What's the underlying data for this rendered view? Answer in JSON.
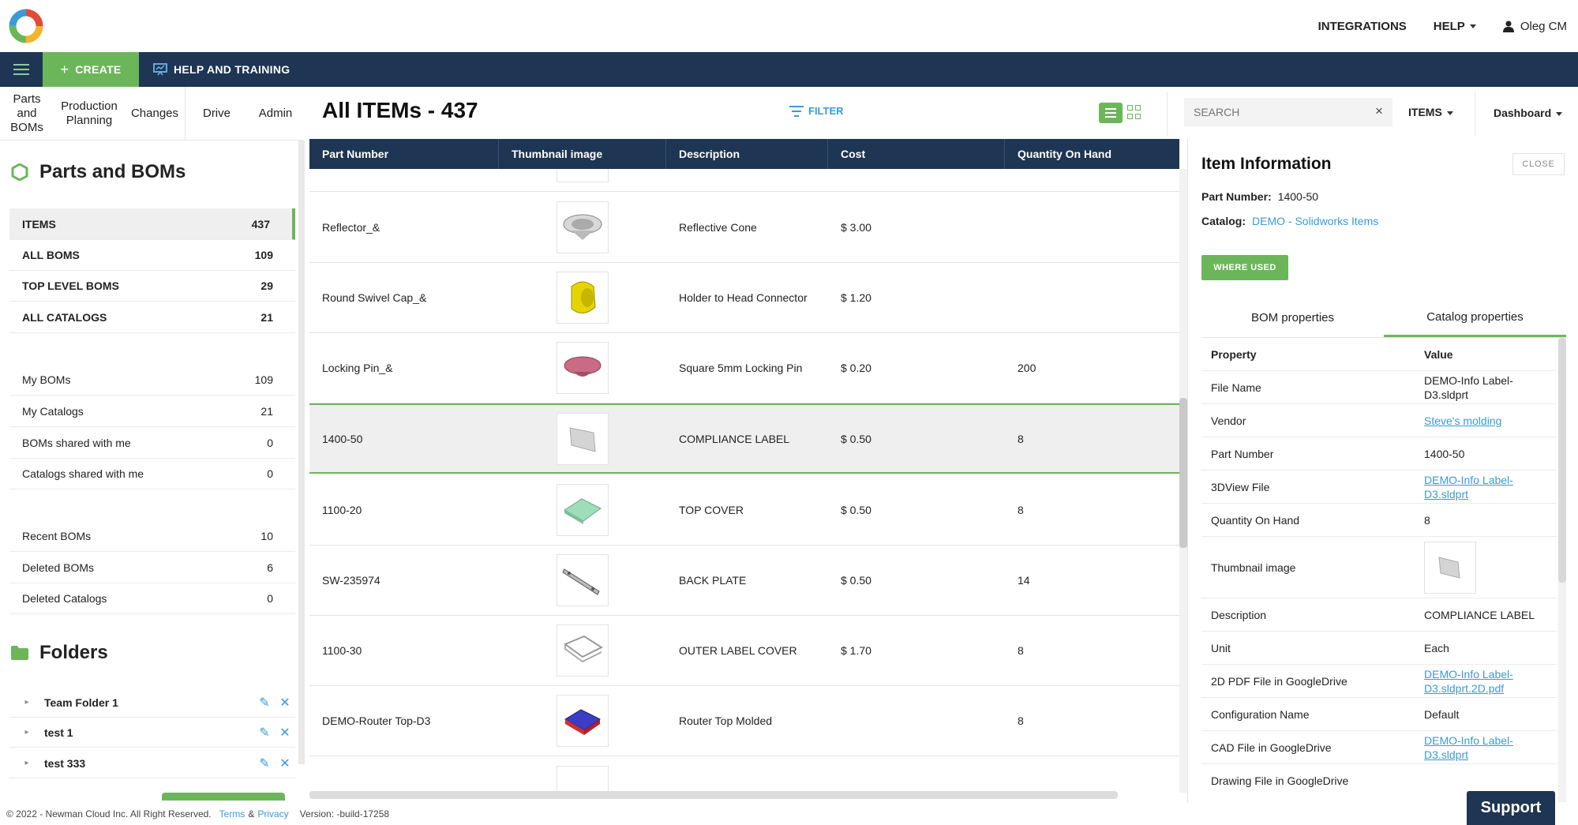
{
  "header": {
    "integrations": "INTEGRATIONS",
    "help": "HELP",
    "user": "Oleg CM"
  },
  "navbar": {
    "create": "CREATE",
    "help_training": "HELP AND TRAINING"
  },
  "module_tabs": [
    {
      "label": "Parts and BOMs"
    },
    {
      "label": "Production Planning"
    },
    {
      "label": "Changes"
    },
    {
      "label": "Drive"
    },
    {
      "label": "Admin"
    }
  ],
  "sidebar": {
    "title": "Parts and BOMs",
    "groups": [
      {
        "label": "ITEMS",
        "count": "437",
        "bold": true,
        "active": true
      },
      {
        "label": "ALL BOMS",
        "count": "109",
        "bold": true
      },
      {
        "label": "TOP LEVEL BOMS",
        "count": "29",
        "bold": true
      },
      {
        "label": "ALL CATALOGS",
        "count": "21",
        "bold": true
      },
      {
        "label": "My BOMs",
        "count": "109"
      },
      {
        "label": "My Catalogs",
        "count": "21"
      },
      {
        "label": "BOMs shared with me",
        "count": "0"
      },
      {
        "label": "Catalogs shared with me",
        "count": "0"
      },
      {
        "label": "Recent BOMs",
        "count": "10"
      },
      {
        "label": "Deleted BOMs",
        "count": "6"
      },
      {
        "label": "Deleted Catalogs",
        "count": "0"
      }
    ],
    "folders_title": "Folders",
    "folders": [
      {
        "name": "Team Folder 1"
      },
      {
        "name": "test 1"
      },
      {
        "name": "test 333"
      }
    ]
  },
  "main": {
    "title": "All ITEMs - 437",
    "filter": "FILTER",
    "search_placeholder": "SEARCH",
    "items_dropdown": "ITEMS",
    "dashboard": "Dashboard"
  },
  "table": {
    "columns": [
      "Part Number",
      "Thumbnail image",
      "Description",
      "Cost",
      "Quantity On Hand"
    ],
    "rows": [
      {
        "part": "Reflector_&",
        "desc": "Reflective Cone",
        "cost": "$ 3.00",
        "qty": "",
        "thumb": "cone"
      },
      {
        "part": "Round Swivel Cap_&",
        "desc": "Holder to Head Connector",
        "cost": "$ 1.20",
        "qty": "",
        "thumb": "cap"
      },
      {
        "part": "Locking Pin_&",
        "desc": "Square 5mm Locking Pin",
        "cost": "$ 0.20",
        "qty": "200",
        "thumb": "pin"
      },
      {
        "part": "1400-50",
        "desc": "COMPLIANCE LABEL",
        "cost": "$ 0.50",
        "qty": "8",
        "thumb": "label",
        "selected": true
      },
      {
        "part": "1100-20",
        "desc": "TOP COVER",
        "cost": "$ 0.50",
        "qty": "8",
        "thumb": "cover"
      },
      {
        "part": "SW-235974",
        "desc": "BACK PLATE",
        "cost": "$ 0.50",
        "qty": "14",
        "thumb": "plate"
      },
      {
        "part": "1100-30",
        "desc": "OUTER LABEL COVER",
        "cost": "$ 1.70",
        "qty": "8",
        "thumb": "outer"
      },
      {
        "part": "DEMO-Router Top-D3",
        "desc": "Router Top Molded",
        "cost": "",
        "qty": "8",
        "thumb": "router"
      }
    ]
  },
  "item_info": {
    "title": "Item Information",
    "close": "CLOSE",
    "part_number_label": "Part Number:",
    "part_number": "1400-50",
    "catalog_label": "Catalog:",
    "catalog": "DEMO - Solidworks Items",
    "where_used": "WHERE USED",
    "tabs": [
      "BOM properties",
      "Catalog properties"
    ],
    "prop_header": {
      "k": "Property",
      "v": "Value"
    },
    "properties": [
      {
        "k": "File Name",
        "v": "DEMO-Info Label-D3.sldprt",
        "link": false
      },
      {
        "k": "Vendor",
        "v": "Steve's molding",
        "link": true
      },
      {
        "k": "Part Number",
        "v": "1400-50",
        "link": false
      },
      {
        "k": "3DView File",
        "v": "DEMO-Info Label-D3.sldprt",
        "link": true
      },
      {
        "k": "Quantity On Hand",
        "v": "8",
        "link": false
      },
      {
        "k": "Thumbnail image",
        "v": "",
        "link": false,
        "thumb": true
      },
      {
        "k": "Description",
        "v": "COMPLIANCE LABEL",
        "link": false
      },
      {
        "k": "Unit",
        "v": "Each",
        "link": false
      },
      {
        "k": "2D PDF File in GoogleDrive",
        "v": "DEMO-Info Label-D3.sldprt.2D.pdf",
        "link": true
      },
      {
        "k": "Configuration Name",
        "v": "Default",
        "link": false
      },
      {
        "k": "CAD File in GoogleDrive",
        "v": "DEMO-Info Label-D3.sldprt",
        "link": true
      },
      {
        "k": "Drawing File in GoogleDrive",
        "v": "",
        "link": false
      }
    ]
  },
  "footer": {
    "copyright": "© 2022 - Newman Cloud Inc. All Right Reserved.",
    "terms": "Terms",
    "amp": "&",
    "privacy": "Privacy",
    "version": "Version: -build-17258"
  },
  "support": "Support",
  "colors": {
    "navy": "#1e3553",
    "green": "#6cb65a",
    "link": "#3a9bd6"
  }
}
